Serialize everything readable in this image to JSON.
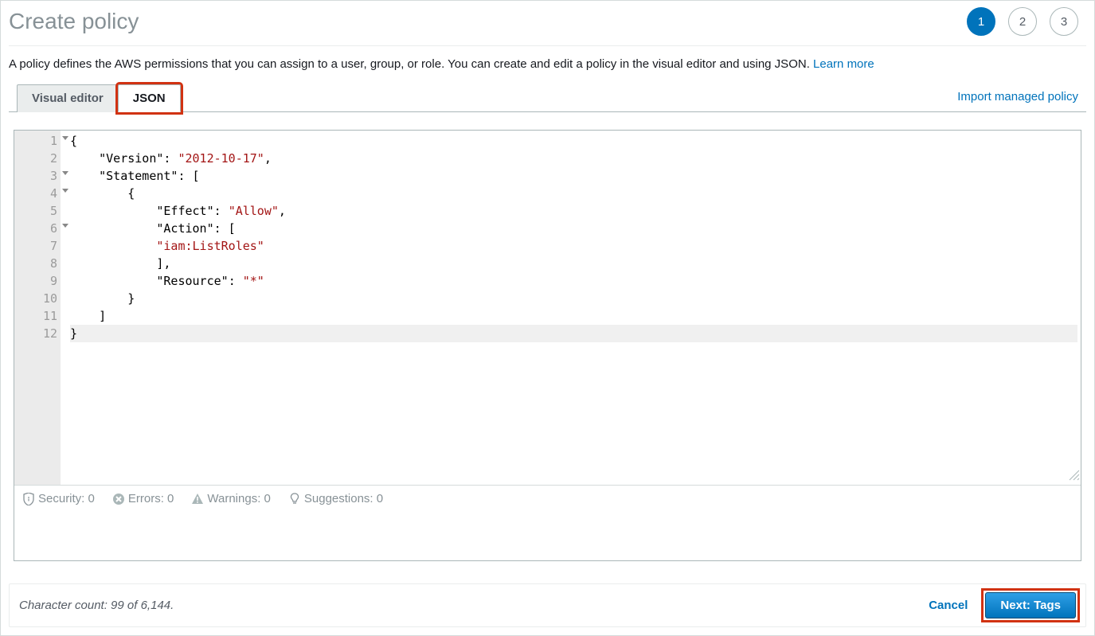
{
  "header": {
    "title": "Create policy",
    "steps": [
      "1",
      "2",
      "3"
    ],
    "active_step_index": 0
  },
  "description": {
    "text": "A policy defines the AWS permissions that you can assign to a user, group, or role. You can create and edit a policy in the visual editor and using JSON. ",
    "learn_more_label": "Learn more"
  },
  "tabs": {
    "visual_editor_label": "Visual editor",
    "json_label": "JSON",
    "active_tab": "json",
    "import_label": "Import managed policy"
  },
  "editor": {
    "line_numbers": [
      "1",
      "2",
      "3",
      "4",
      "5",
      "6",
      "7",
      "8",
      "9",
      "10",
      "11",
      "12"
    ],
    "fold_lines": [
      0,
      2,
      3,
      5
    ],
    "code_lines": [
      {
        "segments": [
          {
            "t": "brace",
            "v": "{"
          }
        ]
      },
      {
        "segments": [
          {
            "t": "ind",
            "v": "    "
          },
          {
            "t": "key",
            "v": "\"Version\""
          },
          {
            "t": "punc",
            "v": ": "
          },
          {
            "t": "str",
            "v": "\"2012-10-17\""
          },
          {
            "t": "punc",
            "v": ","
          }
        ]
      },
      {
        "segments": [
          {
            "t": "ind",
            "v": "    "
          },
          {
            "t": "key",
            "v": "\"Statement\""
          },
          {
            "t": "punc",
            "v": ": ["
          }
        ]
      },
      {
        "segments": [
          {
            "t": "ind",
            "v": "        "
          },
          {
            "t": "brace",
            "v": "{"
          }
        ]
      },
      {
        "segments": [
          {
            "t": "ind",
            "v": "            "
          },
          {
            "t": "key",
            "v": "\"Effect\""
          },
          {
            "t": "punc",
            "v": ": "
          },
          {
            "t": "str",
            "v": "\"Allow\""
          },
          {
            "t": "punc",
            "v": ","
          }
        ]
      },
      {
        "segments": [
          {
            "t": "ind",
            "v": "            "
          },
          {
            "t": "key",
            "v": "\"Action\""
          },
          {
            "t": "punc",
            "v": ": ["
          }
        ]
      },
      {
        "segments": [
          {
            "t": "ind",
            "v": "            "
          },
          {
            "t": "str",
            "v": "\"iam:ListRoles\""
          }
        ]
      },
      {
        "segments": [
          {
            "t": "ind",
            "v": "            "
          },
          {
            "t": "punc",
            "v": "],"
          }
        ]
      },
      {
        "segments": [
          {
            "t": "ind",
            "v": "            "
          },
          {
            "t": "key",
            "v": "\"Resource\""
          },
          {
            "t": "punc",
            "v": ": "
          },
          {
            "t": "str",
            "v": "\"*\""
          }
        ]
      },
      {
        "segments": [
          {
            "t": "ind",
            "v": "        "
          },
          {
            "t": "brace",
            "v": "}"
          }
        ]
      },
      {
        "segments": [
          {
            "t": "ind",
            "v": "    "
          },
          {
            "t": "punc",
            "v": "]"
          }
        ]
      },
      {
        "segments": [
          {
            "t": "brace",
            "v": "}"
          }
        ],
        "current": true
      }
    ]
  },
  "status": {
    "security_label": "Security: 0",
    "errors_label": "Errors: 0",
    "warnings_label": "Warnings: 0",
    "suggestions_label": "Suggestions: 0"
  },
  "footer": {
    "char_count_text": "Character count: 99 of 6,144.",
    "cancel_label": "Cancel",
    "next_label": "Next: Tags"
  }
}
